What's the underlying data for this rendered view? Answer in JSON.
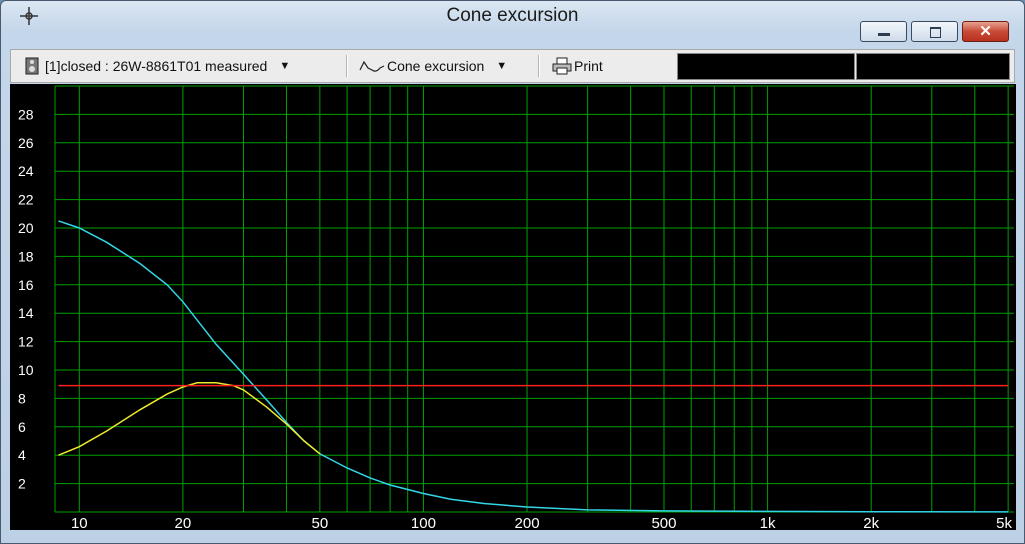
{
  "window": {
    "title": "Cone excursion"
  },
  "toolbar": {
    "project_selector": "[1]closed : 26W-8861T01 measured",
    "graph_selector": "Cone excursion",
    "print_label": "Print"
  },
  "colors": {
    "background": "#000000",
    "grid": "#00a000",
    "axis_text": "#ffffff",
    "series_total": "#33d6e6",
    "series_filtered": "#f0ea2a",
    "limit": "#ff2020"
  },
  "chart_data": {
    "type": "line",
    "title": "Cone excursion",
    "xscale": "log",
    "xlim": [
      8.5,
      5200
    ],
    "ylim": [
      0,
      30
    ],
    "x_tick_labels": [
      "10",
      "20",
      "50",
      "100",
      "200",
      "500",
      "1k",
      "2k",
      "5k"
    ],
    "x_ticks": [
      10,
      20,
      50,
      100,
      200,
      500,
      1000,
      2000,
      5000
    ],
    "y_ticks": [
      2,
      4,
      6,
      8,
      10,
      12,
      14,
      16,
      18,
      20,
      22,
      24,
      26,
      28
    ],
    "grid": true,
    "series": [
      {
        "color": "#33d6e6",
        "x": [
          8.7,
          10,
          12,
          15,
          18,
          20,
          25,
          30,
          35,
          40,
          45,
          50,
          60,
          70,
          80,
          100,
          120,
          150,
          200,
          300,
          500,
          1000,
          2000,
          5000
        ],
        "y": [
          20.5,
          20.0,
          19.0,
          17.5,
          16.0,
          14.8,
          11.8,
          9.7,
          7.9,
          6.3,
          5.0,
          4.1,
          3.1,
          2.4,
          1.9,
          1.3,
          0.9,
          0.6,
          0.35,
          0.15,
          0.08,
          0.04,
          0.02,
          0.01
        ]
      },
      {
        "color": "#f0ea2a",
        "x": [
          8.7,
          10,
          12,
          15,
          18,
          20,
          22,
          25,
          28,
          30,
          35,
          40,
          45,
          50
        ],
        "y": [
          4.0,
          4.6,
          5.7,
          7.2,
          8.3,
          8.8,
          9.1,
          9.1,
          8.9,
          8.6,
          7.4,
          6.2,
          5.0,
          4.1
        ]
      },
      {
        "color": "#ff2020",
        "x": [
          8.7,
          5000
        ],
        "y": [
          8.9,
          8.9
        ]
      }
    ]
  }
}
